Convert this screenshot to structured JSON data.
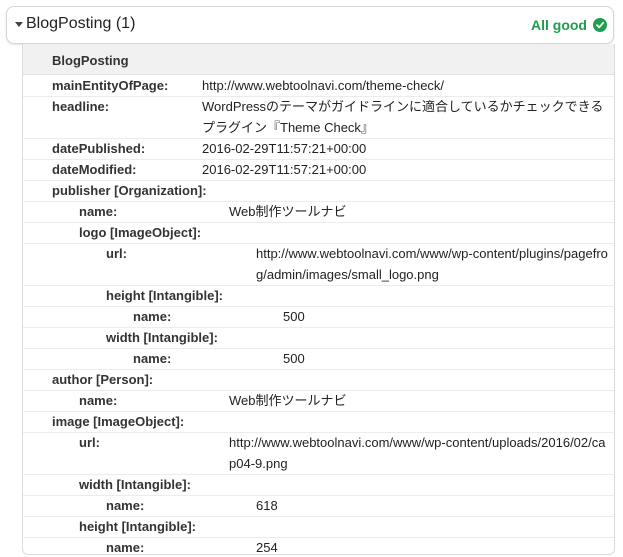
{
  "header": {
    "title": "BlogPosting (1)",
    "status": "All good",
    "status_color": "#1e9e4e"
  },
  "panel": {
    "title": "BlogPosting",
    "rows": [
      {
        "key": "mainEntityOfPage:",
        "value": "http://www.webtoolnavi.com/theme-check/",
        "level": 0,
        "lines": 1
      },
      {
        "key": "headline:",
        "value": "WordPressのテーマがガイドラインに適合しているかチェックできるプラグイン『Theme Check』",
        "level": 0,
        "lines": 2
      },
      {
        "key": "datePublished:",
        "value": "2016-02-29T11:57:21+00:00",
        "level": 0,
        "lines": 1
      },
      {
        "key": "dateModified:",
        "value": "2016-02-29T11:57:21+00:00",
        "level": 0,
        "lines": 1
      },
      {
        "key": "publisher [Organization]:",
        "value": "",
        "level": 0,
        "lines": 1
      },
      {
        "key": "name:",
        "value": "Web制作ツールナビ",
        "level": 1,
        "lines": 1
      },
      {
        "key": "logo [ImageObject]:",
        "value": "",
        "level": 1,
        "lines": 1
      },
      {
        "key": "url:",
        "value": "http://www.webtoolnavi.com/www/wp-content/plugins/pagefrog/admin/images/small_logo.png",
        "level": 2,
        "lines": 2
      },
      {
        "key": "height [Intangible]:",
        "value": "",
        "level": 2,
        "lines": 1
      },
      {
        "key": "name:",
        "value": "500",
        "level": 3,
        "lines": 1
      },
      {
        "key": "width [Intangible]:",
        "value": "",
        "level": 2,
        "lines": 1
      },
      {
        "key": "name:",
        "value": "500",
        "level": 3,
        "lines": 1
      },
      {
        "key": "author [Person]:",
        "value": "",
        "level": 0,
        "lines": 1
      },
      {
        "key": "name:",
        "value": "Web制作ツールナビ",
        "level": 1,
        "lines": 1
      },
      {
        "key": "image [ImageObject]:",
        "value": "",
        "level": 0,
        "lines": 1
      },
      {
        "key": "url:",
        "value": "http://www.webtoolnavi.com/www/wp-content/uploads/2016/02/cap04-9.png",
        "level": 1,
        "lines": 2
      },
      {
        "key": "width [Intangible]:",
        "value": "",
        "level": 1,
        "lines": 1
      },
      {
        "key": "name:",
        "value": "618",
        "level": 2,
        "lines": 1
      },
      {
        "key": "height [Intangible]:",
        "value": "",
        "level": 1,
        "lines": 1
      },
      {
        "key": "name:",
        "value": "254",
        "level": 2,
        "lines": 1
      }
    ]
  }
}
